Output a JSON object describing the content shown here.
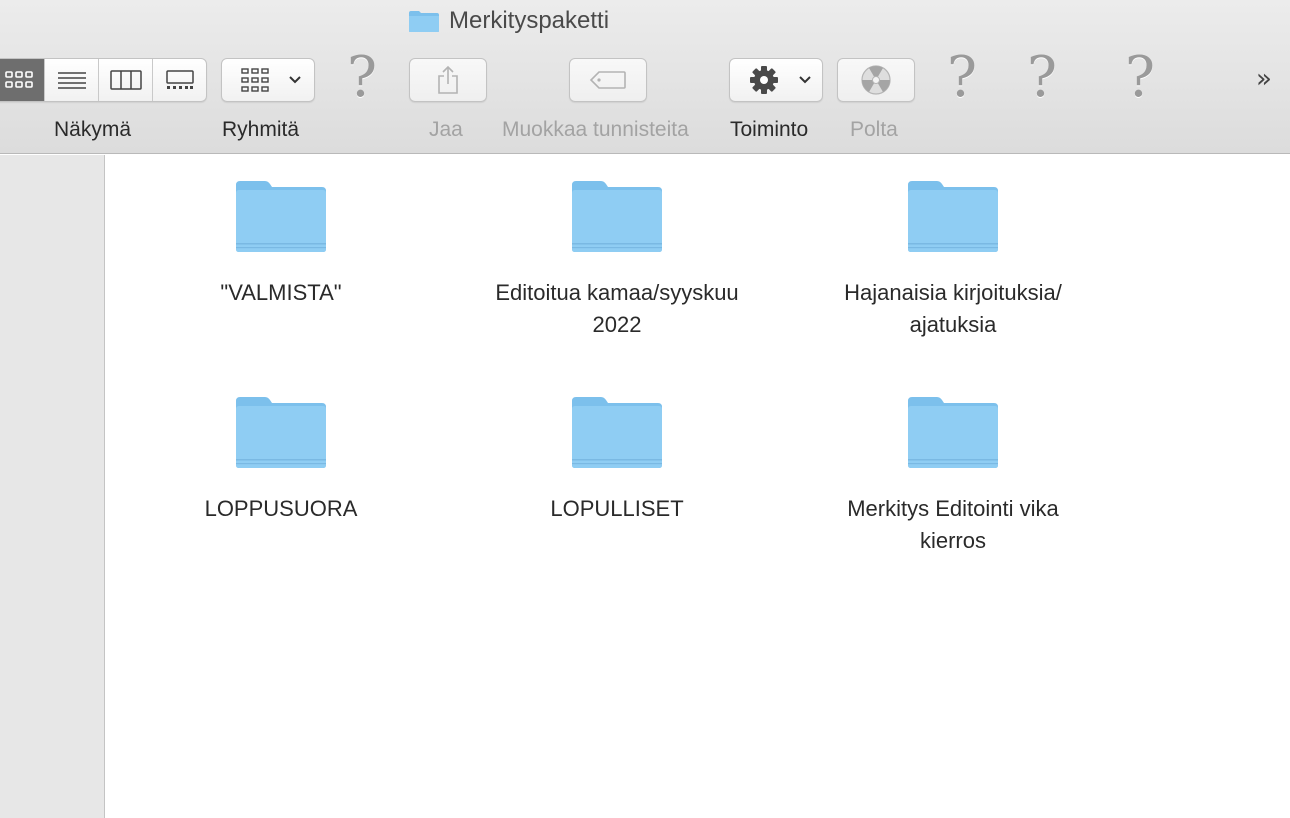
{
  "window": {
    "title": "Merkityspaketti"
  },
  "toolbar": {
    "view_label": "Näkymä",
    "group_label": "Ryhmitä",
    "share_label": "Jaa",
    "tags_label": "Muokkaa tunnisteita",
    "action_label": "Toiminto",
    "burn_label": "Polta",
    "unknown_item_glyph": "?",
    "overflow_glyph": "»"
  },
  "folders": [
    {
      "name": "\"VALMISTA\""
    },
    {
      "name": "Editoitua kamaa/syyskuu 2022"
    },
    {
      "name": "Hajanaisia kirjoituksia/ ajatuksia"
    },
    {
      "name": "LOPPUSUORA"
    },
    {
      "name": "LOPULLISET"
    },
    {
      "name": "Merkitys Editointi vika kierros"
    }
  ],
  "colors": {
    "folder": "#8fcdf3",
    "folder_tab": "#7cc0ec",
    "toolbar_bg": "#e3e3e3",
    "sidebar_bg": "#e7e7e7"
  },
  "icons": [
    "folder-icon",
    "icon-view-icon",
    "list-view-icon",
    "column-view-icon",
    "gallery-view-icon",
    "group-icon",
    "share-icon",
    "tag-icon",
    "gear-icon",
    "burn-icon",
    "question-mark-icon",
    "overflow-chevron-icon"
  ]
}
